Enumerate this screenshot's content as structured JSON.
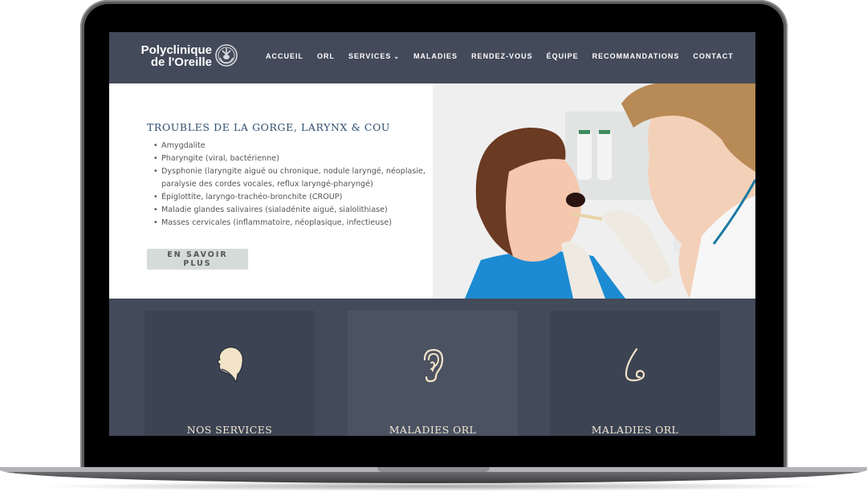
{
  "site": {
    "logo_line1": "Polyclinique",
    "logo_line2": "de l'Oreille",
    "logo_icon": "ear-hands-emblem-icon"
  },
  "nav": {
    "items": [
      {
        "label": "ACCUEIL"
      },
      {
        "label": "ORL"
      },
      {
        "label": "SERVICES",
        "has_dropdown": true
      },
      {
        "label": "MALADIES"
      },
      {
        "label": "RENDEZ-VOUS"
      },
      {
        "label": "ÉQUIPE"
      },
      {
        "label": "RECOMMANDATIONS"
      },
      {
        "label": "CONTACT"
      }
    ]
  },
  "hero": {
    "title": "TROUBLES DE LA GORGE, LARYNX & COU",
    "items": [
      "Amygdalite",
      "Pharyngite (viral, bactérienne)",
      "Dysphonie (laryngite aiguë ou chronique, nodule laryngé, néoplasie, paralysie des cordes vocales, reflux laryngé-pharyngé)",
      "Épiglottite, laryngo-trachéo-bronchite (CROUP)",
      "Maladie glandes salivaires (sialadénite aiguë, sialolithiase)",
      "Masses cervicales (inflammatoire, néoplasique, infectieuse)"
    ],
    "button_label": "EN SAVOIR PLUS",
    "photo_alt": "Médecin examinant la gorge d'un enfant"
  },
  "cards": [
    {
      "label": "NOS SERVICES",
      "icon": "head-throat-icon"
    },
    {
      "label": "MALADIES ORL",
      "icon": "ear-icon"
    },
    {
      "label": "MALADIES ORL",
      "icon": "nose-icon"
    }
  ],
  "colors": {
    "nav_bg": "#434a5a",
    "title": "#2f4f6f",
    "icon_cream": "#f3e4c9",
    "button_bg": "#d4dbd8"
  }
}
